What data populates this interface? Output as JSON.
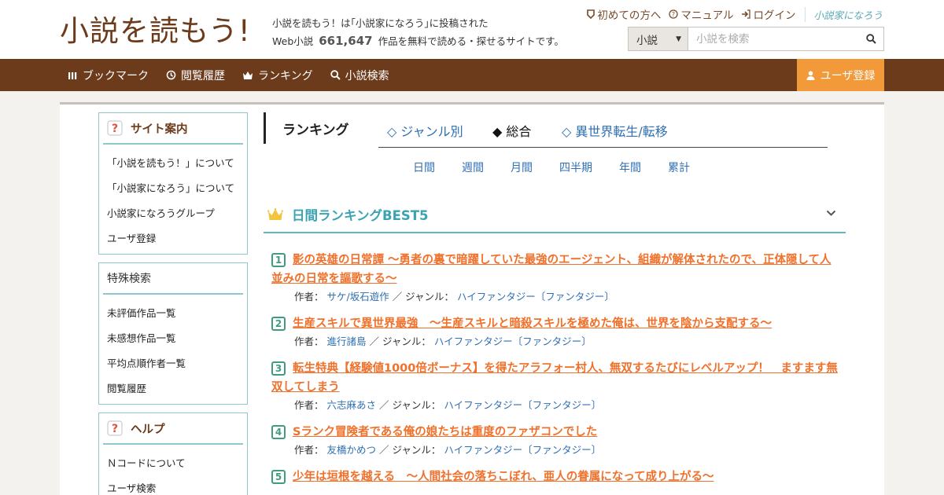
{
  "header": {
    "logo_text": "小説を読もう!",
    "tagline_line1": "小説を読もう！は｢小説家になろう｣に投稿された",
    "tagline_prefix": "Web小説",
    "work_count": "661,647",
    "tagline_suffix": "作品を無料で読める・探せるサイトです。",
    "links": {
      "first_time": "初めての方へ",
      "manual": "マニュアル",
      "login": "ログイン",
      "narou": "小説家になろう"
    },
    "search": {
      "category": "小説",
      "placeholder": "小説を検索"
    }
  },
  "nav": {
    "items": [
      "ブックマーク",
      "閲覧履歴",
      "ランキング",
      "小説検索"
    ],
    "register": "ユーザ登録"
  },
  "sidebar": {
    "site_guide": {
      "title": "サイト案内",
      "items": [
        "「小説を読もう！」について",
        "「小説家になろう」について",
        "小説家になろうグループ",
        "ユーザ登録"
      ]
    },
    "special_search": {
      "title": "特殊検索",
      "items": [
        "未評価作品一覧",
        "未感想作品一覧",
        "平均点順作者一覧",
        "閲覧履歴"
      ]
    },
    "help": {
      "title": "ヘルプ",
      "items": [
        "Ｎコードについて",
        "ユーザ検索"
      ]
    }
  },
  "ranking": {
    "title": "ランキング",
    "tabs": [
      "◇ ジャンル別",
      "◆ 総合",
      "◇ 異世界転生/転移"
    ],
    "periods": [
      "日間",
      "週間",
      "月間",
      "四半期",
      "年間",
      "累計"
    ],
    "best_title": "日間ランキングBEST5",
    "author_label": "作者：",
    "genre_label": "／ ジャンル：",
    "items": [
      {
        "rank": "1",
        "title": "影の英雄の日常譚 ～勇者の裏で暗躍していた最強のエージェント、組織が解体されたので、正体隠して人並みの日常を謳歌する～",
        "author": "サケ/坂石遊作",
        "genre": "ハイファンタジー〔ファンタジー〕"
      },
      {
        "rank": "2",
        "title": "生産スキルで異世界最強　～生産スキルと暗殺スキルを極めた俺は、世界を陰から支配する～",
        "author": "進行諸島",
        "genre": "ハイファンタジー〔ファンタジー〕"
      },
      {
        "rank": "3",
        "title": "転生特典【経験値1000倍ボーナス】を得たアラフォー村人、無双するたびにレベルアップ！　ますます無双してしまう",
        "author": "六志麻あさ",
        "genre": "ハイファンタジー〔ファンタジー〕"
      },
      {
        "rank": "4",
        "title": "Sランク冒険者である俺の娘たちは重度のファザコンでした",
        "author": "友橋かめつ",
        "genre": "ハイファンタジー〔ファンタジー〕"
      },
      {
        "rank": "5",
        "title": "少年は垣根を越える　～人間社会の落ちこぼれ、亜人の眷属になって成り上がる～",
        "author": "",
        "genre": ""
      }
    ]
  }
}
